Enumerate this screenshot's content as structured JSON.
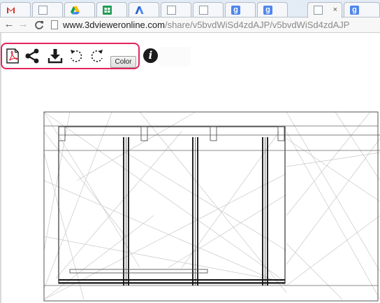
{
  "tabs": [
    {
      "icon": "gmail-icon",
      "letter": "M",
      "active": false
    },
    {
      "icon": "document-icon",
      "letter": "",
      "active": false
    },
    {
      "icon": "google-drive-icon",
      "letter": "",
      "active": false
    },
    {
      "icon": "spreadsheet-icon",
      "letter": "",
      "active": false
    },
    {
      "icon": "adwords-icon",
      "letter": "",
      "active": false
    },
    {
      "icon": "document-icon",
      "letter": "",
      "active": false
    },
    {
      "icon": "document-icon",
      "letter": "",
      "active": false
    },
    {
      "icon": "google-plus-icon",
      "letter": "g",
      "active": false
    },
    {
      "icon": "google-plus-icon",
      "letter": "g",
      "active": false
    },
    {
      "icon": "document-icon",
      "letter": "",
      "active": true,
      "close": "×"
    },
    {
      "icon": "google-plus-icon",
      "letter": "g",
      "active": false
    }
  ],
  "address_bar": {
    "domain": "www.3dvieweronline.com",
    "path": "/share/v5bvdWiSd4zdAJP/v5bvdWiSd4zdAJP",
    "back_glyph": "←",
    "forward_glyph": "→",
    "reload_glyph": "C"
  },
  "viewer_toolbar": {
    "tools": [
      "pdf-export-icon",
      "share-icon",
      "download-icon",
      "rotate-left-icon",
      "rotate-right-icon"
    ],
    "color_button_label": "Color",
    "info_glyph": "i",
    "highlight_color": "#e4245a"
  }
}
